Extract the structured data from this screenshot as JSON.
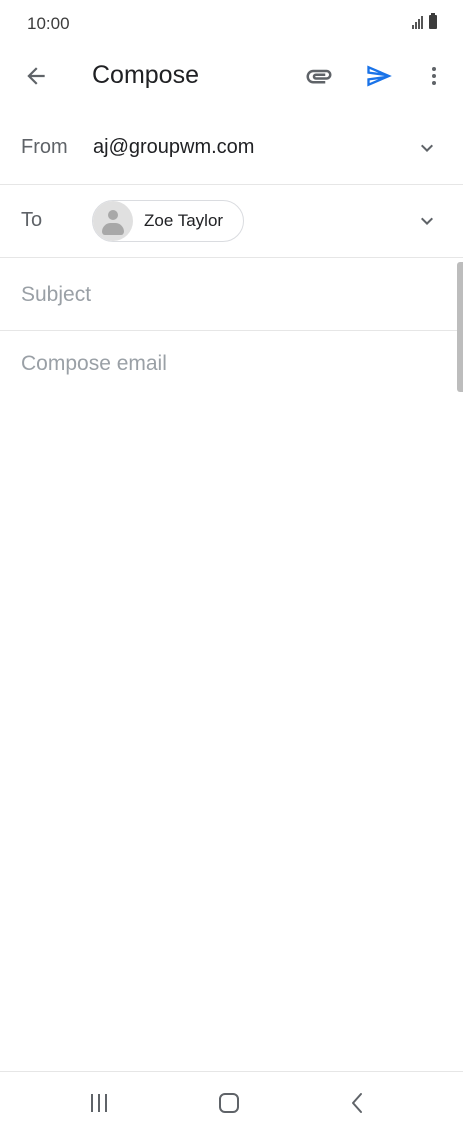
{
  "status_bar": {
    "time": "10:00"
  },
  "app_bar": {
    "title": "Compose"
  },
  "from_row": {
    "label": "From",
    "value": "aj@groupwm.com"
  },
  "to_row": {
    "label": "To",
    "recipients": [
      {
        "name": "Zoe Taylor"
      }
    ]
  },
  "subject": {
    "placeholder": "Subject"
  },
  "body": {
    "placeholder": "Compose email"
  },
  "colors": {
    "accent": "#1a73e8",
    "icon": "#5f6368",
    "placeholder": "#9aa0a6",
    "divider": "#e6e6e6"
  },
  "icons": {
    "back": "arrow-left-icon",
    "attach": "paperclip-icon",
    "send": "send-icon",
    "more": "more-vert-icon",
    "expand": "chevron-down-icon",
    "nav_recent": "recent-apps-icon",
    "nav_home": "home-icon",
    "nav_back": "nav-back-icon"
  }
}
